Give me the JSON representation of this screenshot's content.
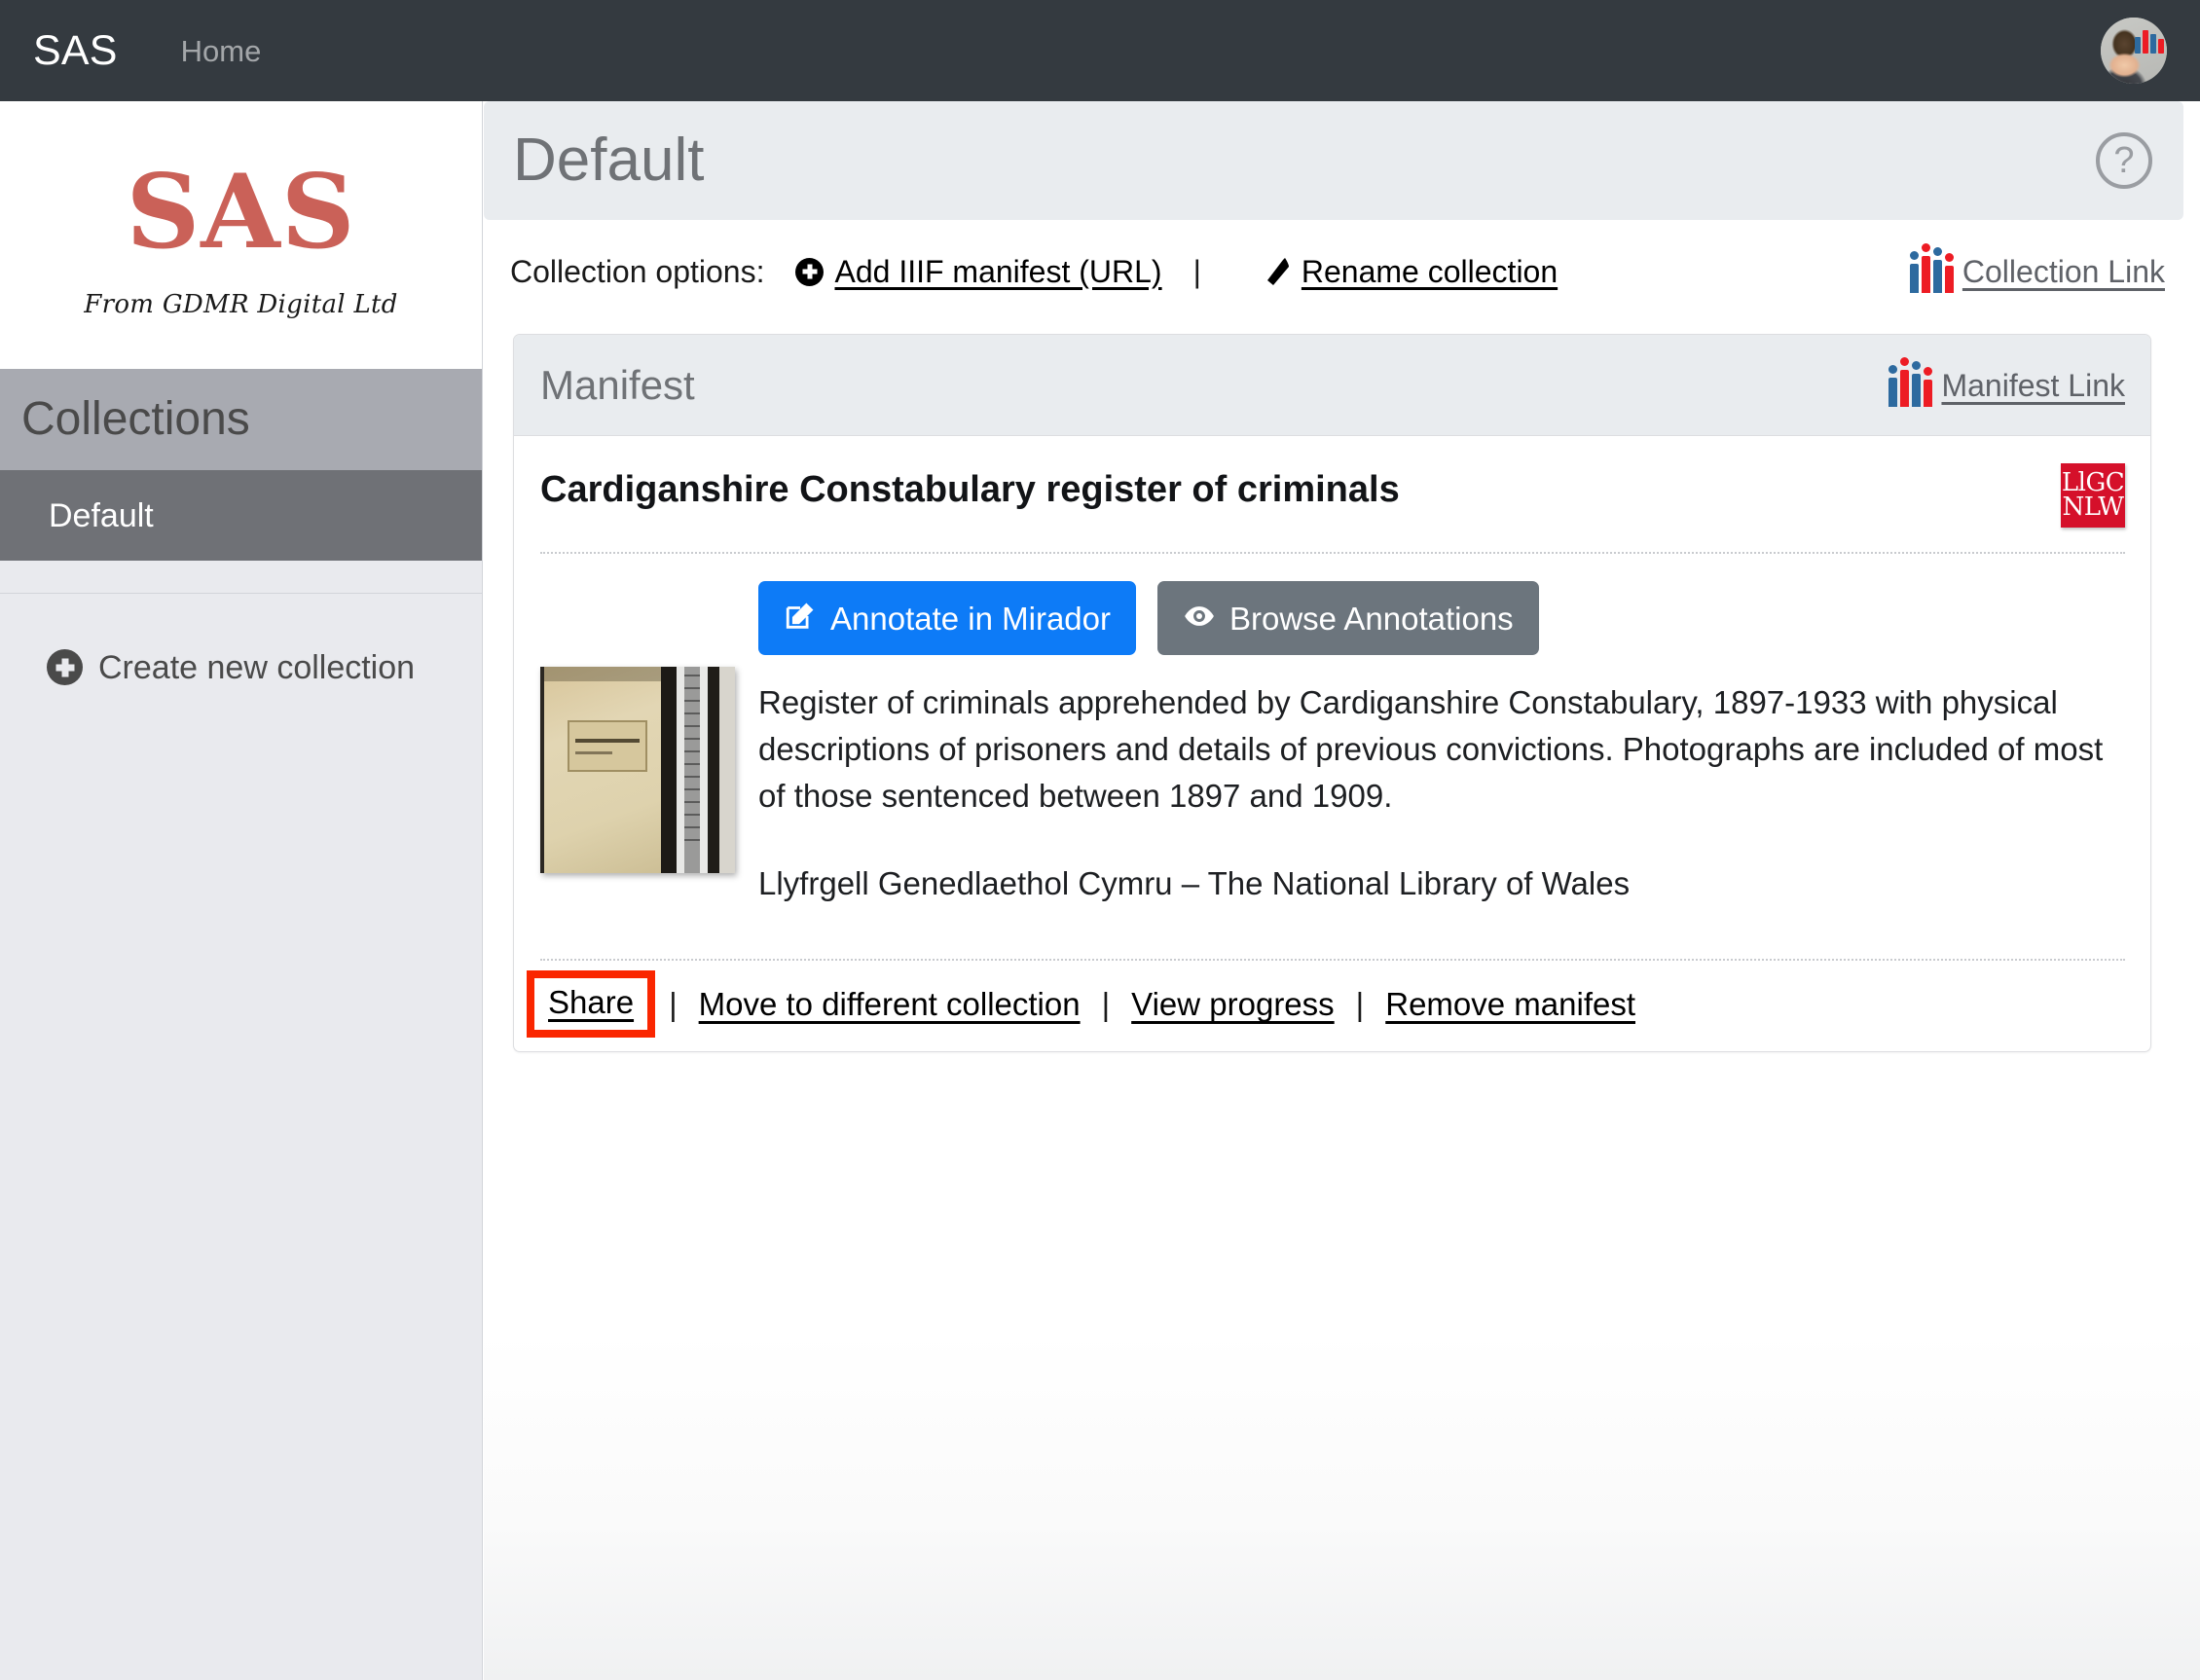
{
  "navbar": {
    "brand": "SAS",
    "home_label": "Home",
    "avatar_name": "user-avatar"
  },
  "sidebar": {
    "logo_text": "SAS",
    "logo_subtitle": "From GDMR Digital Ltd",
    "collections_header": "Collections",
    "items": [
      {
        "label": "Default",
        "selected": true
      }
    ],
    "create_new_label": "Create new collection"
  },
  "header": {
    "title": "Default",
    "help_glyph": "?"
  },
  "collection_options": {
    "label": "Collection options:",
    "add_manifest_label": "Add IIIF manifest (URL)",
    "separator": "|",
    "rename_label": "Rename collection",
    "collection_link_label": "Collection Link"
  },
  "manifest_card": {
    "header_title": "Manifest",
    "manifest_link_label": "Manifest Link",
    "title": "Cardiganshire Constabulary register of criminals",
    "institution_logo_line1": "LlGC",
    "institution_logo_line2": "NLW",
    "buttons": {
      "annotate_label": "Annotate in Mirador",
      "browse_label": "Browse Annotations"
    },
    "description": "Register of criminals apprehended by Cardiganshire Constabulary, 1897-1933 with physical descriptions of prisoners and details of previous convictions. Photographs are included of most of those sentenced between 1897 and 1909.",
    "attribution": "Llyfrgell Genedlaethol Cymru – The National Library of Wales",
    "actions": [
      {
        "label": "Share",
        "highlighted": true
      },
      {
        "label": "Move to different collection",
        "highlighted": false
      },
      {
        "label": "View progress",
        "highlighted": false
      },
      {
        "label": "Remove manifest",
        "highlighted": false
      }
    ],
    "action_separator": "|"
  },
  "colors": {
    "navbar_bg": "#343a40",
    "brand_red": "#ca6158",
    "sidebar_bg": "#e9eaee",
    "collections_header_bg": "#a8aab1",
    "selected_item_bg": "#6f7176",
    "primary_button": "#0d7bf7",
    "secondary_button": "#6c757d",
    "highlight_box": "#fa2600",
    "nlw_red": "#d5102a",
    "iiif_blue": "#2d6a9f",
    "iiif_red": "#ed1c24"
  }
}
